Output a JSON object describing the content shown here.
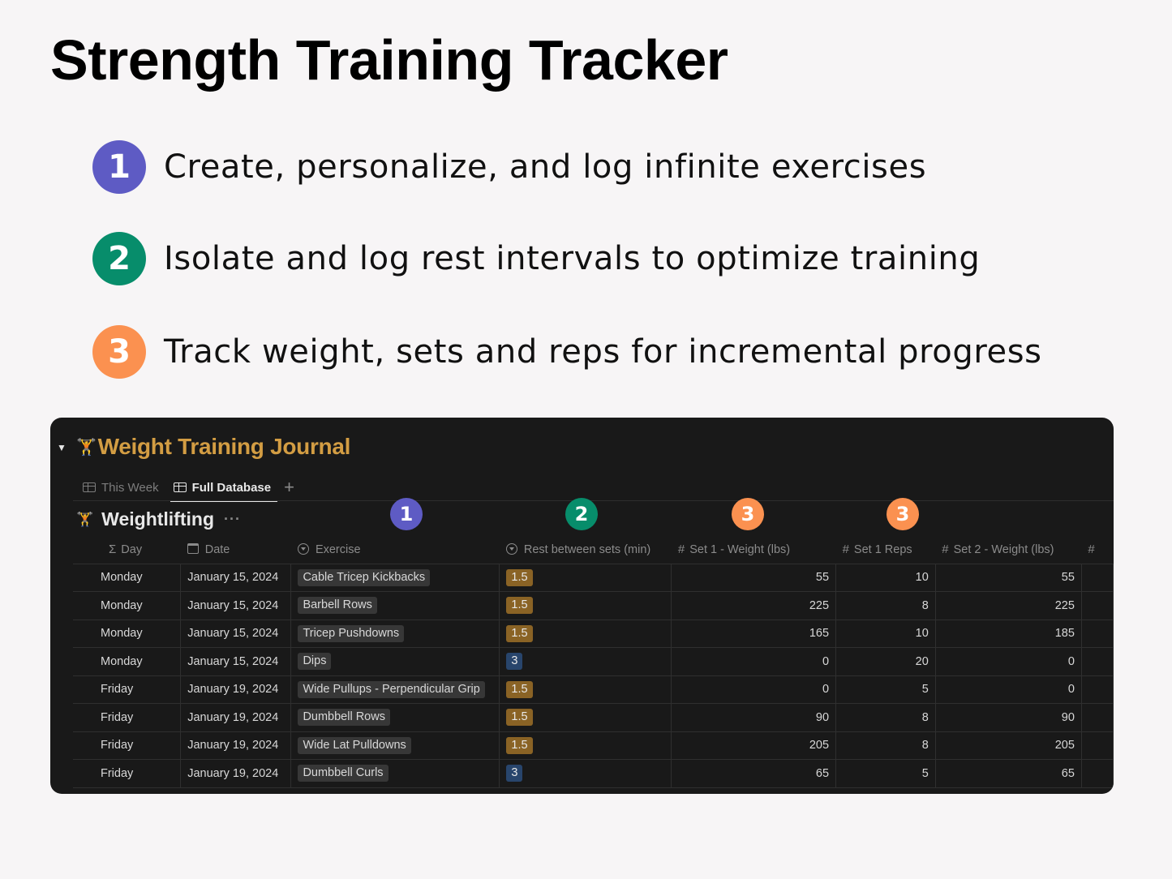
{
  "page": {
    "title": "Strength Training Tracker"
  },
  "features": [
    {
      "number": "1",
      "color": "#5e5bc4",
      "text": "Create, personalize, and log infinite exercises"
    },
    {
      "number": "2",
      "color": "#078d6b",
      "text": "Isolate and log rest intervals to optimize training"
    },
    {
      "number": "3",
      "color": "#fb9150",
      "text": "Track weight, sets and reps for incremental progress"
    }
  ],
  "journal": {
    "toggle_icon": "triangle-down-icon",
    "emoji": "🏋",
    "title": "Weight Training Journal",
    "title_color": "#d39d43",
    "tabs": [
      {
        "label": "This Week",
        "icon": "table-icon",
        "active": false
      },
      {
        "label": "Full Database",
        "icon": "table-icon",
        "active": true
      }
    ],
    "add_tab": "+",
    "database": {
      "emoji": "🏋",
      "title": "Weightlifting",
      "more": "···"
    },
    "column_markers": [
      {
        "number": "1",
        "color": "#5e5bc4",
        "column": "Exercise"
      },
      {
        "number": "2",
        "color": "#078d6b",
        "column": "Rest between sets (min)"
      },
      {
        "number": "3",
        "color": "#fb9150",
        "column": "Set 1 - Weight (lbs)"
      },
      {
        "number": "3",
        "color": "#fb9150",
        "column": "Set 1 Reps"
      }
    ],
    "columns": [
      {
        "label": "Day",
        "icon": "sigma-icon",
        "glyph": "Σ"
      },
      {
        "label": "Date",
        "icon": "calendar-icon",
        "glyph": ""
      },
      {
        "label": "Exercise",
        "icon": "select-icon",
        "glyph": ""
      },
      {
        "label": "Rest between sets (min)",
        "icon": "select-icon",
        "glyph": ""
      },
      {
        "label": "Set 1 - Weight (lbs)",
        "icon": "number-icon",
        "glyph": "#"
      },
      {
        "label": "Set 1 Reps",
        "icon": "number-icon",
        "glyph": "#"
      },
      {
        "label": "Set 2 - Weight (lbs)",
        "icon": "number-icon",
        "glyph": "#"
      },
      {
        "label": "",
        "icon": "number-icon",
        "glyph": "#"
      }
    ],
    "rest_colors": {
      "1.5": "#8a6325",
      "3": "#28456c"
    },
    "rows": [
      {
        "day": "Monday",
        "date": "January 15, 2024",
        "exercise": "Cable Tricep Kickbacks",
        "rest": "1.5",
        "set1_weight": "55",
        "set1_reps": "10",
        "set2_weight": "55"
      },
      {
        "day": "Monday",
        "date": "January 15, 2024",
        "exercise": "Barbell Rows",
        "rest": "1.5",
        "set1_weight": "225",
        "set1_reps": "8",
        "set2_weight": "225"
      },
      {
        "day": "Monday",
        "date": "January 15, 2024",
        "exercise": "Tricep Pushdowns",
        "rest": "1.5",
        "set1_weight": "165",
        "set1_reps": "10",
        "set2_weight": "185"
      },
      {
        "day": "Monday",
        "date": "January 15, 2024",
        "exercise": "Dips",
        "rest": "3",
        "set1_weight": "0",
        "set1_reps": "20",
        "set2_weight": "0"
      },
      {
        "day": "Friday",
        "date": "January 19, 2024",
        "exercise": "Wide Pullups - Perpendicular Grip",
        "rest": "1.5",
        "set1_weight": "0",
        "set1_reps": "5",
        "set2_weight": "0"
      },
      {
        "day": "Friday",
        "date": "January 19, 2024",
        "exercise": "Dumbbell Rows",
        "rest": "1.5",
        "set1_weight": "90",
        "set1_reps": "8",
        "set2_weight": "90"
      },
      {
        "day": "Friday",
        "date": "January 19, 2024",
        "exercise": "Wide Lat Pulldowns",
        "rest": "1.5",
        "set1_weight": "205",
        "set1_reps": "8",
        "set2_weight": "205"
      },
      {
        "day": "Friday",
        "date": "January 19, 2024",
        "exercise": "Dumbbell Curls",
        "rest": "3",
        "set1_weight": "65",
        "set1_reps": "5",
        "set2_weight": "65"
      }
    ]
  }
}
